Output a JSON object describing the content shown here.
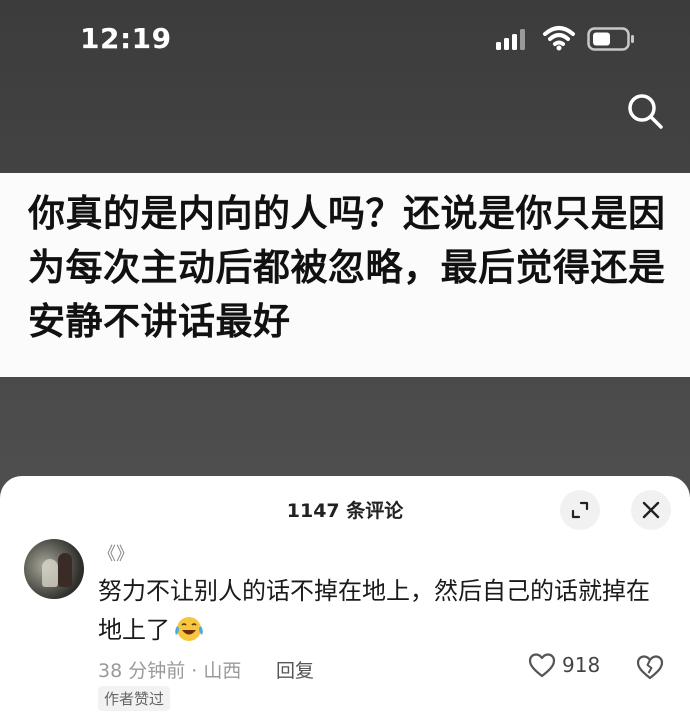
{
  "status_bar": {
    "time": "12:19"
  },
  "post": {
    "title": "你真的是内向的人吗？还说是你只是因为每次主动后都被忽略，最后觉得还是安静不讲话最好"
  },
  "comments_sheet": {
    "count_label": "1147 条评论",
    "comment": {
      "username": "《》",
      "text": "努力不让别人的话不掉在地上，然后自己的话就掉在地上了",
      "emoji": "crying-laughing-emoji",
      "meta": "38 分钟前 · 山西",
      "reply_label": "回复",
      "likes": "918",
      "badge": "作者赞过"
    }
  },
  "colors": {
    "background": "#4a4a4a",
    "card": "#fbfbfb",
    "sheet": "#ffffff",
    "text_primary": "#1a1a1a",
    "text_secondary": "#9a9a9a"
  }
}
